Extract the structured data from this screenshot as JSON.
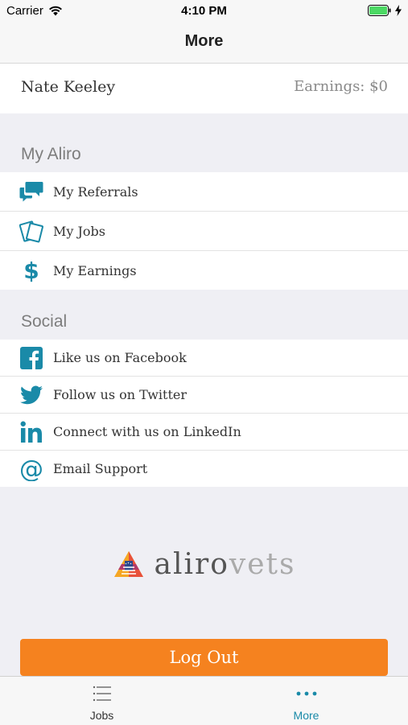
{
  "status_bar": {
    "carrier": "Carrier",
    "time": "4:10 PM"
  },
  "nav": {
    "title": "More"
  },
  "profile": {
    "name": "Nate Keeley",
    "earnings": "Earnings: $0"
  },
  "sections": {
    "my_aliro": {
      "header": "My Aliro",
      "items": [
        {
          "label": "My Referrals",
          "icon": "chat-bubbles-icon"
        },
        {
          "label": "My Jobs",
          "icon": "cards-icon"
        },
        {
          "label": "My Earnings",
          "icon": "dollar-icon"
        }
      ]
    },
    "social": {
      "header": "Social",
      "items": [
        {
          "label": "Like us on Facebook",
          "icon": "facebook-icon"
        },
        {
          "label": "Follow us on Twitter",
          "icon": "twitter-icon"
        },
        {
          "label": "Connect with us on LinkedIn",
          "icon": "linkedin-icon"
        },
        {
          "label": "Email Support",
          "icon": "at-sign-icon"
        }
      ]
    }
  },
  "logo": {
    "part1": "aliro",
    "part2": "vets"
  },
  "logout": {
    "label": "Log Out"
  },
  "tabs": [
    {
      "label": "Jobs",
      "icon": "list-icon",
      "active": false
    },
    {
      "label": "More",
      "icon": "more-dots-icon",
      "active": true
    }
  ],
  "colors": {
    "accent": "#1a8aa8",
    "logout": "#f5821f",
    "tab_active": "#1a8aa8"
  }
}
